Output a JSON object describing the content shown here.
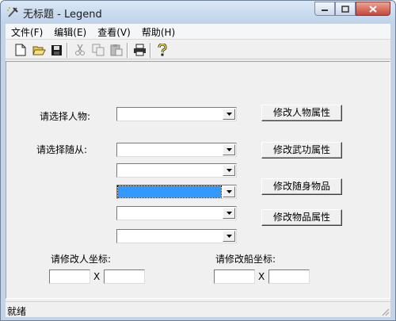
{
  "window": {
    "title": "无标题 - Legend"
  },
  "menu": [
    "文件(F)",
    "编辑(E)",
    "查看(V)",
    "帮助(H)"
  ],
  "toolbar": {
    "icons": [
      "new-file-icon",
      "open-folder-icon",
      "save-icon",
      "cut-icon",
      "copy-icon",
      "paste-icon",
      "print-icon",
      "help-icon"
    ]
  },
  "form": {
    "character_label": "请选择人物:",
    "follower_label": "请选择随从:",
    "buttons": {
      "edit_character": "修改人物属性",
      "edit_martial": "修改武功属性",
      "edit_carried": "修改随身物品",
      "edit_items": "修改物品属性"
    },
    "person_coord_label": "请修改人坐标:",
    "ship_coord_label": "请修改船坐标:",
    "coord_sep": "X",
    "fields": {
      "person_x": "",
      "person_y": "",
      "ship_x": "",
      "ship_y": ""
    }
  },
  "status": {
    "text": "就绪"
  }
}
